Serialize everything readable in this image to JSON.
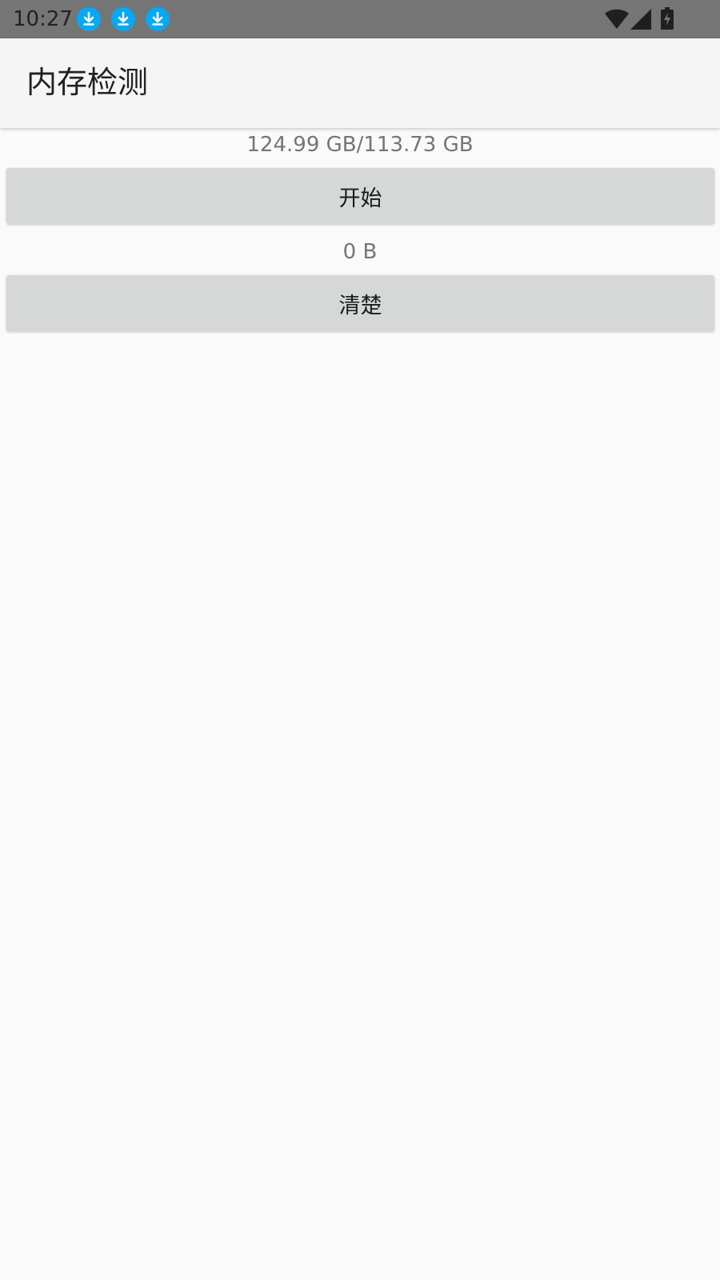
{
  "status_bar": {
    "time": "10:27",
    "notification_icons": [
      "download-icon",
      "download-icon",
      "download-icon"
    ],
    "icons": [
      "wifi-icon",
      "cell-signal-icon",
      "battery-charging-icon"
    ],
    "accent_color": "#03a9f4"
  },
  "app_bar": {
    "title": "内存检测"
  },
  "main": {
    "memory_text": "124.99 GB/113.73 GB",
    "start_button_label": "开始",
    "size_text": "0 B",
    "clear_button_label": "清楚"
  }
}
